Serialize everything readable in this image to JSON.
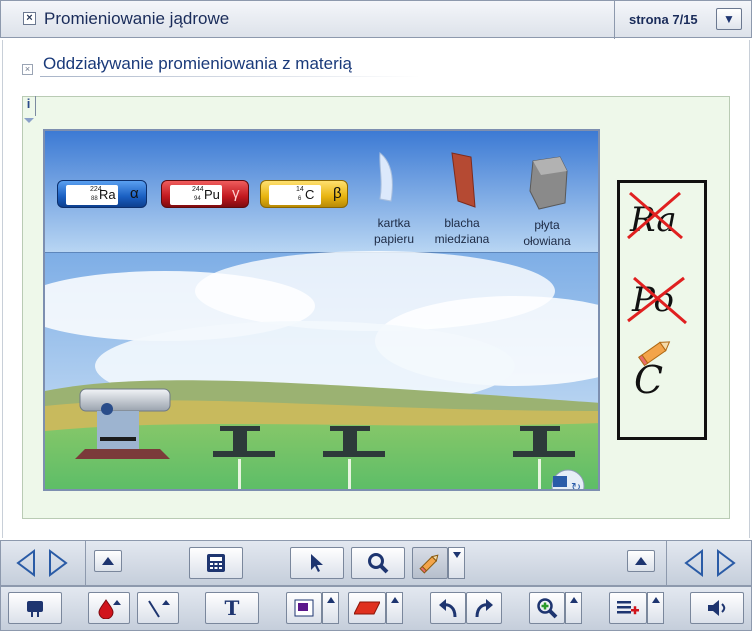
{
  "window": {
    "title": "Promieniowanie jądrowe",
    "page_indicator": "strona 7/15"
  },
  "section": {
    "title": "Oddziaływanie promieniowania z materią"
  },
  "simulation": {
    "sources": [
      {
        "element": "Ra",
        "mass": "224",
        "atomic": "88",
        "radiation": "α",
        "color": "#1e6fd0"
      },
      {
        "element": "Pu",
        "mass": "244",
        "atomic": "94",
        "radiation": "γ",
        "color": "#cc1f26"
      },
      {
        "element": "C",
        "mass": "14",
        "atomic": "6",
        "radiation": "β",
        "color": "#e8b810"
      }
    ],
    "absorbers": [
      {
        "label_line1": "kartka",
        "label_line2": "papieru",
        "color": "#e3eefc"
      },
      {
        "label_line1": "blacha",
        "label_line2": "miedziana",
        "color": "#b24a34"
      },
      {
        "label_line1": "płyta",
        "label_line2": "ołowiana",
        "color": "#7d7d7d"
      }
    ]
  },
  "notes": {
    "handwritten": [
      "Ra",
      "Po",
      "C"
    ]
  },
  "toolbar_top": {
    "left_group": [
      "prev-arrow",
      "next-arrow",
      "scroll-up"
    ],
    "tools": [
      "calculator-icon",
      "cursor-icon",
      "magnifier-icon",
      "pencil-icon"
    ],
    "right_group": [
      "scroll-up",
      "prev-arrow",
      "next-arrow"
    ]
  },
  "toolbar_bottom": {
    "text_tool_label": "T"
  },
  "colors": {
    "accent": "#1a3a7a",
    "sky_top": "#3f7fd6",
    "grass": "#6fc06a"
  }
}
